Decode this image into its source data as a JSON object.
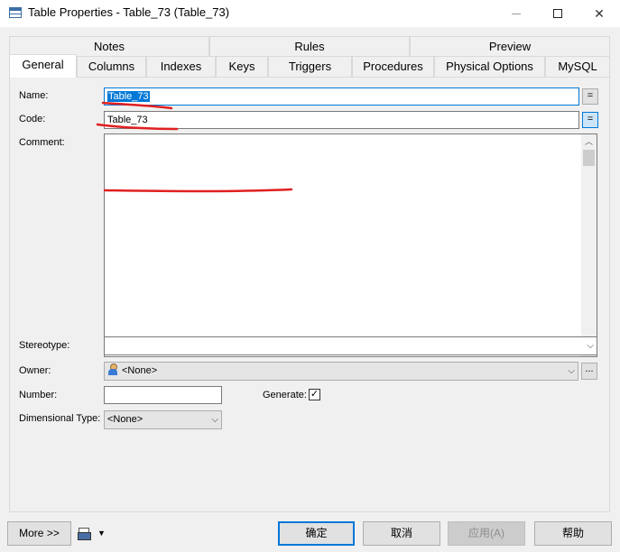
{
  "window": {
    "title": "Table Properties - Table_73 (Table_73)",
    "min_icon": "minimize-icon",
    "max_icon": "maximize-icon",
    "close_glyph": "✕"
  },
  "tabs_back": [
    "Notes",
    "Rules",
    "Preview"
  ],
  "tabs_front": [
    {
      "label": "General",
      "active": true
    },
    {
      "label": "Columns"
    },
    {
      "label": "Indexes"
    },
    {
      "label": "Keys"
    },
    {
      "label": "Triggers"
    },
    {
      "label": "Procedures"
    },
    {
      "label": "Physical Options"
    },
    {
      "label": "MySQL"
    }
  ],
  "form": {
    "name_label": "Name:",
    "name_value": "Table_73",
    "code_label": "Code:",
    "code_value": "Table_73",
    "eq_glyph": "=",
    "comment_label": "Comment:",
    "comment_value": "",
    "stereotype_label": "Stereotype:",
    "stereotype_value": "",
    "owner_label": "Owner:",
    "owner_value": "<None>",
    "owner_browse": "...",
    "number_label": "Number:",
    "number_value": "",
    "generate_label": "Generate:",
    "generate_checked": "✓",
    "dimensional_type_label": "Dimensional Type:",
    "dimensional_type_value": "<None>",
    "combo_arrow": "⌵"
  },
  "buttons": {
    "more": "More >>",
    "ok": "确定",
    "cancel": "取消",
    "apply": "应用(A)",
    "help": "帮助",
    "print_caret": "▼"
  },
  "scroll": {
    "up": "︿",
    "down": "﹀"
  },
  "colors": {
    "accent": "#0078d7",
    "annotation": "#e02020",
    "dialog_bg": "#f0f0f0"
  }
}
